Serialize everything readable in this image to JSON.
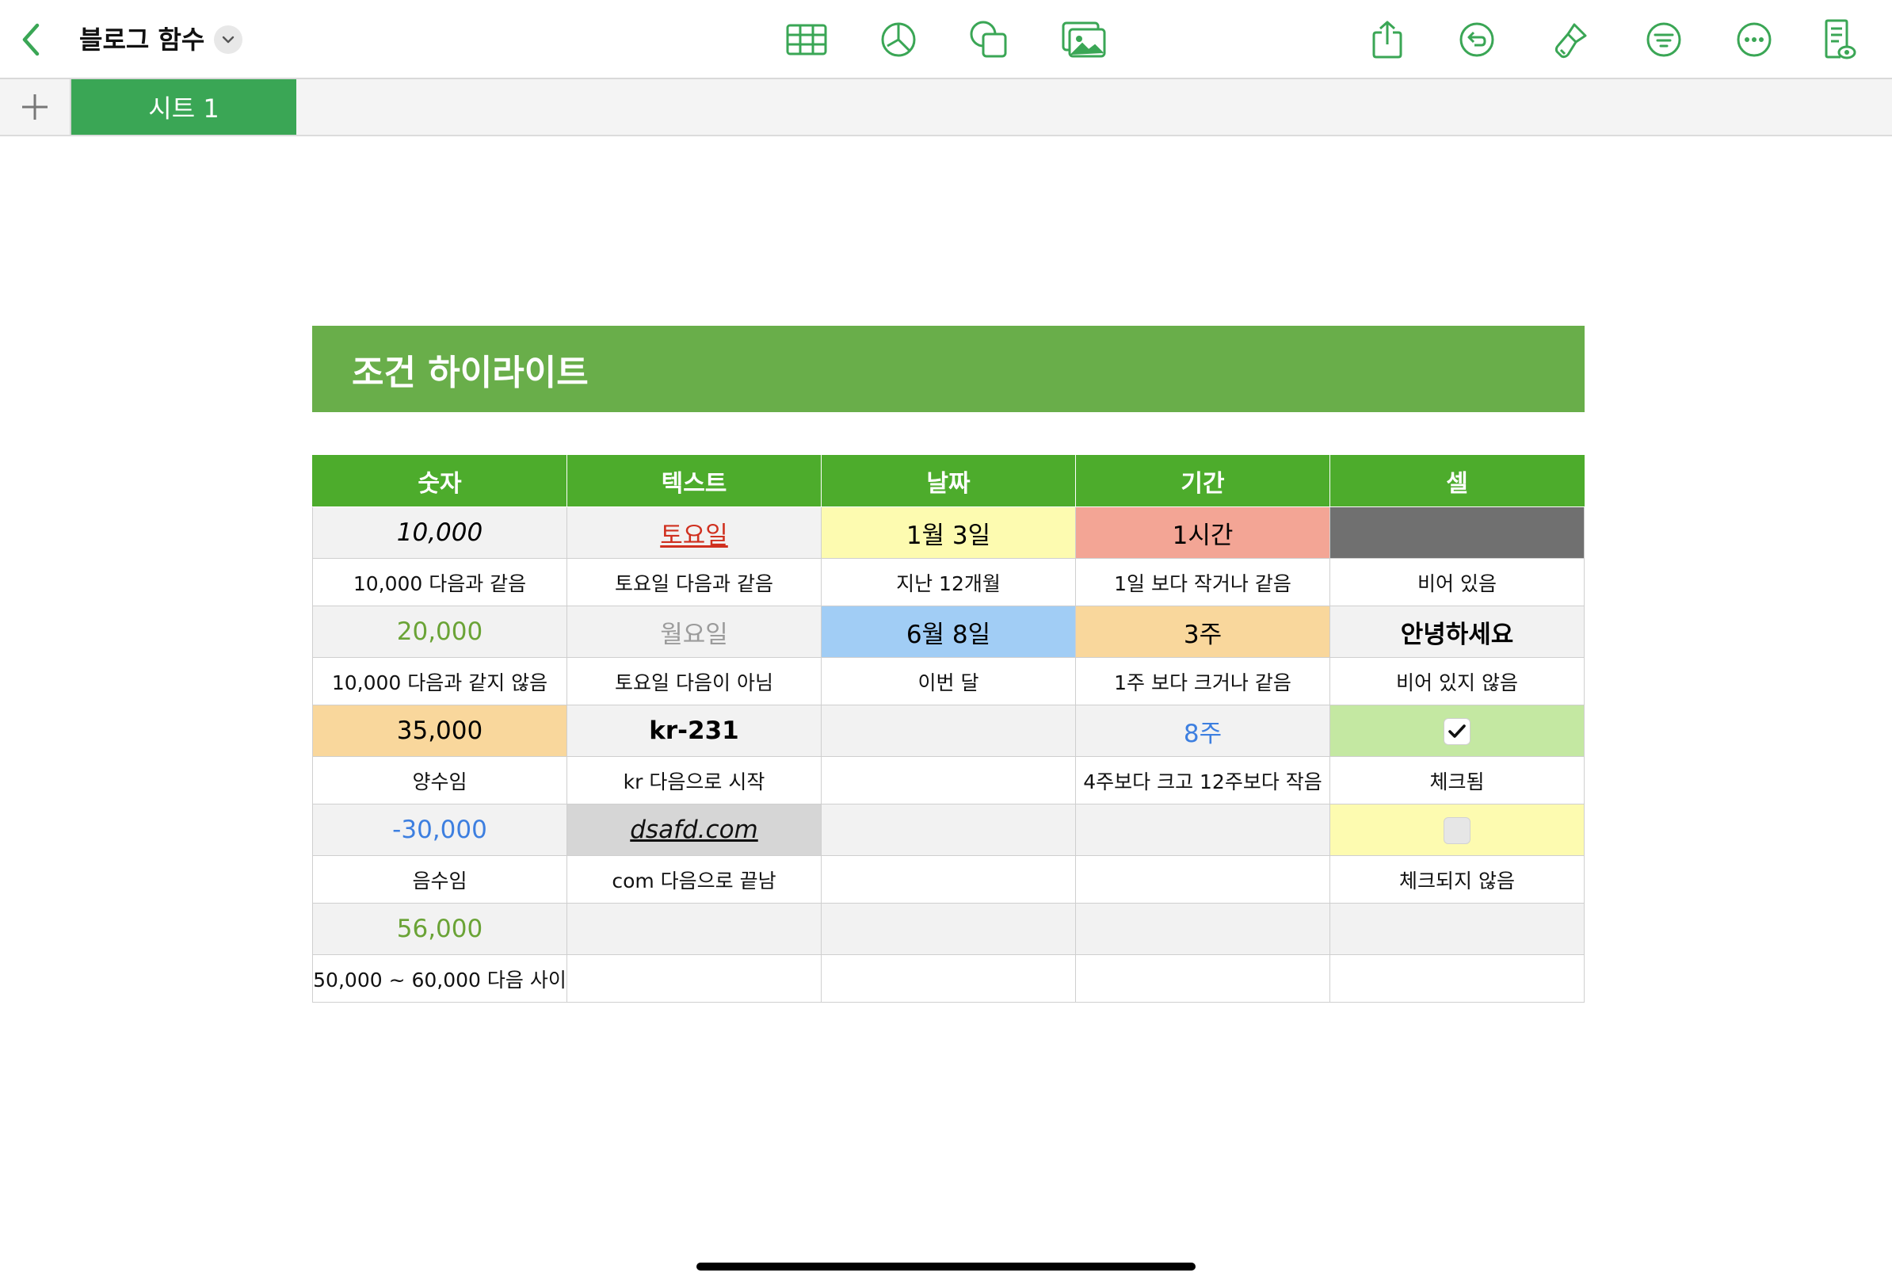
{
  "app": {
    "doc_title": "블로그 함수",
    "accent": "#3aa655",
    "toolbar_icons": [
      "table-icon",
      "chart-icon",
      "shape-icon",
      "media-icon",
      "share-icon",
      "undo-icon",
      "format-brush-icon",
      "organize-icon",
      "more-icon",
      "view-options-icon"
    ]
  },
  "sheets": {
    "active_tab": "시트 1"
  },
  "table": {
    "title": "조건 하이라이트",
    "headers": [
      "숫자",
      "텍스트",
      "날짜",
      "기간",
      "셀"
    ],
    "rows": [
      {
        "type": "value",
        "cells": [
          {
            "text": "10,000",
            "color": "#000000",
            "bg": "#f2f2f2",
            "italic": true
          },
          {
            "text": "토요일",
            "color": "#d0301f",
            "bg": "#f2f2f2",
            "underline": true
          },
          {
            "text": "1월 3일",
            "color": "#000000",
            "bg": "#fdfbb0"
          },
          {
            "text": "1시간",
            "color": "#000000",
            "bg": "#f3a595"
          },
          {
            "text": "",
            "color": "#000000",
            "bg": "#707070"
          }
        ]
      },
      {
        "type": "label",
        "cells": [
          {
            "text": "10,000 다음과 같음"
          },
          {
            "text": "토요일 다음과 같음"
          },
          {
            "text": "지난 12개월"
          },
          {
            "text": "1일 보다 작거나 같음"
          },
          {
            "text": "비어 있음"
          }
        ]
      },
      {
        "type": "value",
        "cells": [
          {
            "text": "20,000",
            "color": "#6aa336",
            "bg": "#f2f2f2"
          },
          {
            "text": "월요일",
            "color": "#9b9b9b",
            "bg": "#f2f2f2"
          },
          {
            "text": "6월 8일",
            "color": "#000000",
            "bg": "#a1cdf5"
          },
          {
            "text": "3주",
            "color": "#000000",
            "bg": "#f9d79c"
          },
          {
            "text": "안녕하세요",
            "color": "#000000",
            "bg": "#f2f2f2",
            "bold": true
          }
        ]
      },
      {
        "type": "label",
        "cells": [
          {
            "text": "10,000 다음과 같지 않음"
          },
          {
            "text": "토요일 다음이 아님"
          },
          {
            "text": "이번 달"
          },
          {
            "text": "1주 보다 크거나 같음"
          },
          {
            "text": "비어 있지 않음"
          }
        ]
      },
      {
        "type": "value",
        "cells": [
          {
            "text": "35,000",
            "color": "#000000",
            "bg": "#f9d79c"
          },
          {
            "text": "kr-231",
            "color": "#000000",
            "bg": "#f2f2f2",
            "bold": true
          },
          {
            "text": "",
            "bg": "#f2f2f2"
          },
          {
            "text": "8주",
            "color": "#3d7fe0",
            "bg": "#f2f2f2"
          },
          {
            "text": "",
            "bg": "#c4e8a2",
            "checkbox": "checked"
          }
        ]
      },
      {
        "type": "label",
        "cells": [
          {
            "text": "양수임"
          },
          {
            "text": "kr 다음으로 시작"
          },
          {
            "text": ""
          },
          {
            "text": "4주보다 크고 12주보다 작음"
          },
          {
            "text": "체크됨"
          }
        ]
      },
      {
        "type": "value",
        "cells": [
          {
            "text": "-30,000",
            "color": "#3d7fe0",
            "bg": "#f2f2f2"
          },
          {
            "text": "dsafd.com",
            "color": "#111111",
            "bg": "#d6d6d6",
            "italic": true,
            "underline": true
          },
          {
            "text": "",
            "bg": "#f2f2f2"
          },
          {
            "text": "",
            "bg": "#f2f2f2"
          },
          {
            "text": "",
            "bg": "#fdfbb0",
            "checkbox": "unchecked"
          }
        ]
      },
      {
        "type": "label",
        "cells": [
          {
            "text": "음수임"
          },
          {
            "text": "com 다음으로 끝남"
          },
          {
            "text": ""
          },
          {
            "text": ""
          },
          {
            "text": "체크되지 않음"
          }
        ]
      },
      {
        "type": "value",
        "cells": [
          {
            "text": "56,000",
            "color": "#6aa336",
            "bg": "#f2f2f2"
          },
          {
            "text": "",
            "bg": "#f2f2f2"
          },
          {
            "text": "",
            "bg": "#f2f2f2"
          },
          {
            "text": "",
            "bg": "#f2f2f2"
          },
          {
            "text": "",
            "bg": "#f2f2f2"
          }
        ]
      },
      {
        "type": "label",
        "cells": [
          {
            "text": "50,000 ~ 60,000 다음 사이"
          },
          {
            "text": ""
          },
          {
            "text": ""
          },
          {
            "text": ""
          },
          {
            "text": ""
          }
        ]
      }
    ]
  }
}
